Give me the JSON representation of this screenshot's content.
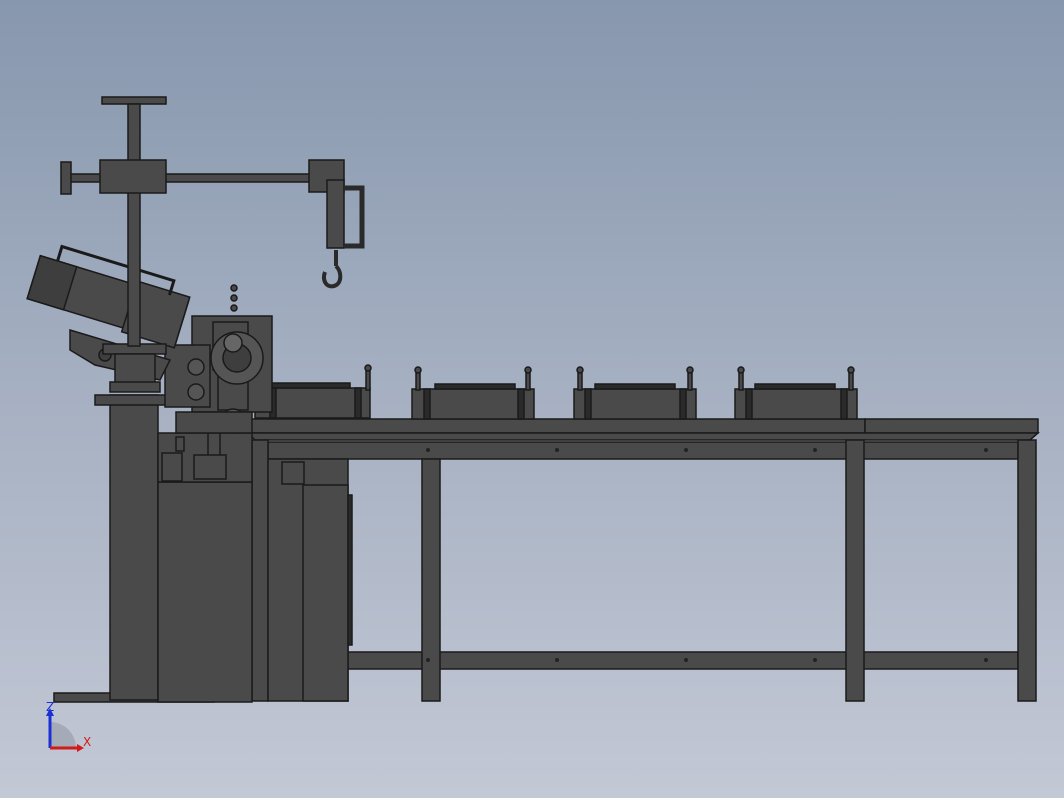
{
  "viewport": {
    "background_top": "#8797ae",
    "background_bottom": "#c3c8d5"
  },
  "model": {
    "body_color": "#4a4a4a",
    "edge_color": "#1a1a1a",
    "hub_color": "#5a5a5a"
  },
  "triad": {
    "z_label": "Z",
    "x_label": "X",
    "z_color": "#1a2fd6",
    "x_color": "#d11a1a"
  }
}
